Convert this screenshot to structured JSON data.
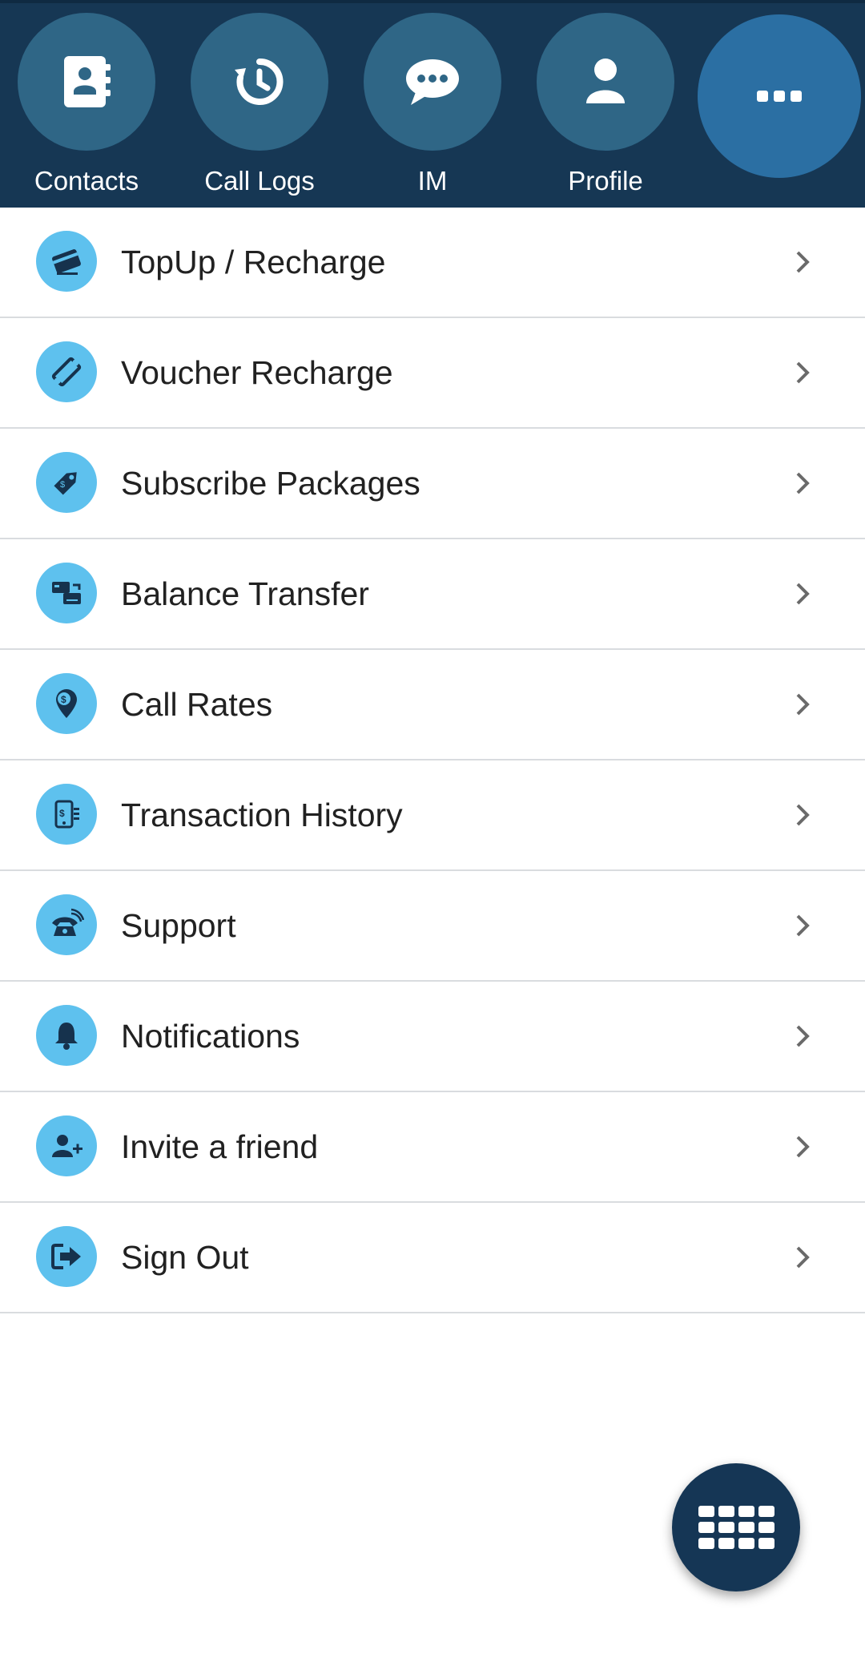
{
  "nav": {
    "items": [
      {
        "label": "Contacts",
        "icon": "contacts-book-icon"
      },
      {
        "label": "Call Logs",
        "icon": "history-clock-icon"
      },
      {
        "label": "IM",
        "icon": "chat-bubble-icon"
      },
      {
        "label": "Profile",
        "icon": "user-icon"
      }
    ],
    "more_icon": "more-dots-icon"
  },
  "menu": {
    "items": [
      {
        "label": "TopUp / Recharge",
        "icon": "credit-card-icon"
      },
      {
        "label": "Voucher Recharge",
        "icon": "ticket-icon"
      },
      {
        "label": "Subscribe Packages",
        "icon": "price-tag-icon"
      },
      {
        "label": "Balance Transfer",
        "icon": "transfer-cards-icon"
      },
      {
        "label": "Call Rates",
        "icon": "dollar-pin-icon"
      },
      {
        "label": "Transaction History",
        "icon": "phone-receipt-icon"
      },
      {
        "label": "Support",
        "icon": "telephone-icon"
      },
      {
        "label": "Notifications",
        "icon": "bell-icon"
      },
      {
        "label": "Invite a friend",
        "icon": "add-user-icon"
      },
      {
        "label": "Sign Out",
        "icon": "sign-out-icon"
      }
    ]
  },
  "fab": {
    "icon": "dialpad-icon"
  },
  "colors": {
    "topbar": "#163754",
    "nav_circle": "#2f6686",
    "more_button": "#2b6fa3",
    "menu_icon_bg": "#5ec1ee",
    "menu_icon_fg": "#16324d",
    "fab": "#153655"
  }
}
